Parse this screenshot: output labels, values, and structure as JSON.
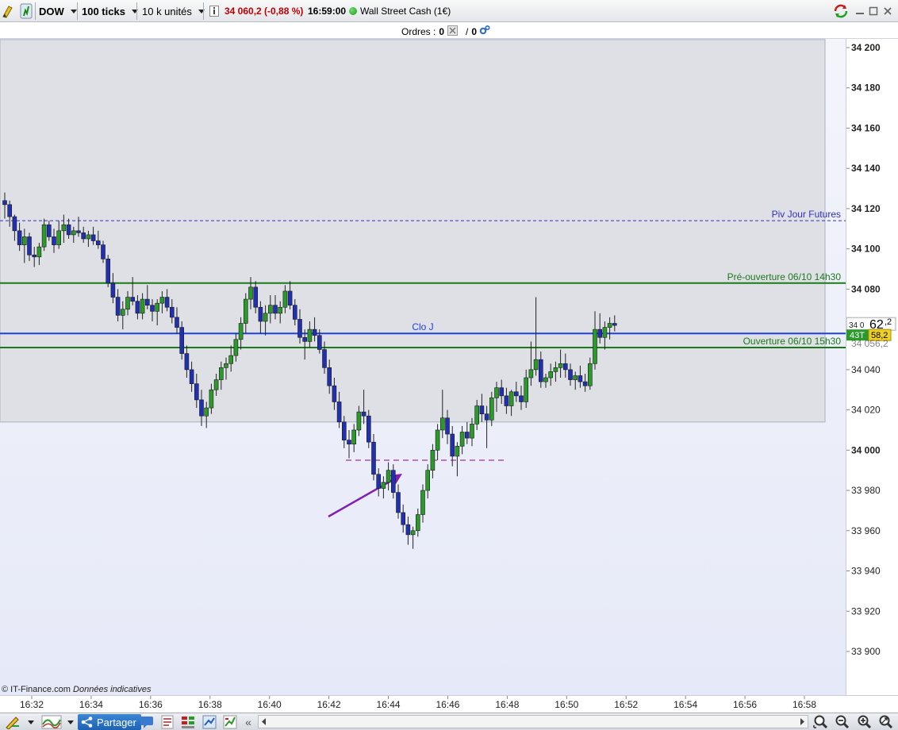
{
  "toolbar": {
    "instrument": "DOW",
    "ticks": "100 ticks",
    "units": "10 k unités",
    "price_change": "34 060,2 (-0,88 %)",
    "time": "16:59:00",
    "market_name": "Wall Street Cash (1€)",
    "icons": [
      "drawing-tool-icon",
      "price-alert-icon",
      "window-minimize-icon",
      "window-restore-icon",
      "window-close-icon",
      "refresh-icon"
    ]
  },
  "orders": {
    "label": "Ordres :",
    "count": "0",
    "slash": "/",
    "count2": "0"
  },
  "chart_data": {
    "type": "candlestick",
    "instrument": "DOW",
    "ylim": [
      33880,
      34205
    ],
    "y_ticks": [
      "34 200",
      "34 180",
      "34 160",
      "34 140",
      "34 120",
      "34 100",
      "34 080",
      "34 060",
      "34 040",
      "34 020",
      "34 000",
      "33 980",
      "33 960",
      "33 940",
      "33 920",
      "33 900"
    ],
    "y_tick_values": [
      34200,
      34180,
      34160,
      34140,
      34120,
      34100,
      34080,
      34060,
      34040,
      34020,
      34000,
      33980,
      33960,
      33940,
      33920,
      33900
    ],
    "x_ticks": [
      "16:32",
      "16:34",
      "16:36",
      "16:38",
      "16:40",
      "16:42",
      "16:44",
      "16:46",
      "16:48",
      "16:50",
      "16:52",
      "16:54",
      "16:56",
      "16:58"
    ],
    "levels": [
      {
        "label": "Piv Jour Futures",
        "value": 34114,
        "color": "#3030c0",
        "style": "dashed"
      },
      {
        "label": "Pré-ouverture 06/10 14h30",
        "value": 34083,
        "color": "#1a7a1a",
        "style": "solid"
      },
      {
        "label": "Clo J",
        "value": 34058,
        "color": "#1e40e0",
        "style": "solid"
      },
      {
        "label": "Ouverture 06/10 15h30",
        "value": 34051,
        "color": "#1a7a1a",
        "style": "solid"
      }
    ],
    "range_box": {
      "top": 34204,
      "bottom": 34014
    },
    "support_line": {
      "value": 33995,
      "from_time": "16:43.8",
      "to_time": "16:47.8",
      "color": "#a030a0"
    },
    "candles": [
      [
        34124,
        34128,
        34115,
        34122
      ],
      [
        34122,
        34124,
        34111,
        34116
      ],
      [
        34116,
        34117,
        34104,
        34109
      ],
      [
        34109,
        34113,
        34099,
        34102
      ],
      [
        34102,
        34110,
        34093,
        34106
      ],
      [
        34106,
        34108,
        34094,
        34097
      ],
      [
        34097,
        34101,
        34091,
        34096
      ],
      [
        34096,
        34103,
        34092,
        34101
      ],
      [
        34101,
        34115,
        34099,
        34112
      ],
      [
        34112,
        34114,
        34104,
        34106
      ],
      [
        34106,
        34110,
        34098,
        34102
      ],
      [
        34102,
        34114,
        34100,
        34109
      ],
      [
        34109,
        34117,
        34103,
        34112
      ],
      [
        34112,
        34115,
        34105,
        34107
      ],
      [
        34107,
        34111,
        34103,
        34109
      ],
      [
        34109,
        34116,
        34106,
        34108
      ],
      [
        34108,
        34111,
        34103,
        34105
      ],
      [
        34105,
        34109,
        34101,
        34107
      ],
      [
        34107,
        34111,
        34102,
        34104
      ],
      [
        34104,
        34109,
        34100,
        34102
      ],
      [
        34102,
        34104,
        34093,
        34095
      ],
      [
        34095,
        34097,
        34081,
        34083
      ],
      [
        34083,
        34088,
        34073,
        34076
      ],
      [
        34076,
        34080,
        34064,
        34067
      ],
      [
        34067,
        34074,
        34060,
        34070
      ],
      [
        34070,
        34079,
        34067,
        34076
      ],
      [
        34076,
        34086,
        34072,
        34074
      ],
      [
        34074,
        34077,
        34065,
        34068
      ],
      [
        34068,
        34078,
        34065,
        34075
      ],
      [
        34075,
        34082,
        34070,
        34072
      ],
      [
        34072,
        34075,
        34064,
        34069
      ],
      [
        34069,
        34075,
        34062,
        34073
      ],
      [
        34073,
        34079,
        34068,
        34076
      ],
      [
        34076,
        34080,
        34069,
        34071
      ],
      [
        34071,
        34075,
        34063,
        34066
      ],
      [
        34066,
        34071,
        34058,
        34061
      ],
      [
        34061,
        34064,
        34045,
        34048
      ],
      [
        34048,
        34052,
        34036,
        34040
      ],
      [
        34040,
        34044,
        34029,
        34033
      ],
      [
        34033,
        34038,
        34021,
        34025
      ],
      [
        34025,
        34030,
        34012,
        34017
      ],
      [
        34017,
        34024,
        34011,
        34021
      ],
      [
        34021,
        34033,
        34018,
        34030
      ],
      [
        34030,
        34038,
        34027,
        34035
      ],
      [
        34035,
        34044,
        34030,
        34041
      ],
      [
        34041,
        34046,
        34035,
        34043
      ],
      [
        34043,
        34052,
        34039,
        34047
      ],
      [
        34047,
        34058,
        34044,
        34055
      ],
      [
        34055,
        34066,
        34050,
        34063
      ],
      [
        34063,
        34078,
        34058,
        34075
      ],
      [
        34075,
        34086,
        34070,
        34081
      ],
      [
        34081,
        34084,
        34068,
        34071
      ],
      [
        34071,
        34074,
        34058,
        34064
      ],
      [
        34064,
        34072,
        34057,
        34068
      ],
      [
        34068,
        34077,
        34063,
        34072
      ],
      [
        34072,
        34077,
        34065,
        34068
      ],
      [
        34068,
        34074,
        34063,
        34071
      ],
      [
        34071,
        34082,
        34068,
        34079
      ],
      [
        34079,
        34084,
        34070,
        34072
      ],
      [
        34072,
        34075,
        34062,
        34065
      ],
      [
        34065,
        34070,
        34053,
        34056
      ],
      [
        34056,
        34060,
        34045,
        34054
      ],
      [
        34054,
        34064,
        34051,
        34060
      ],
      [
        34060,
        34066,
        34054,
        34057
      ],
      [
        34057,
        34060,
        34048,
        34050
      ],
      [
        34050,
        34054,
        34038,
        34041
      ],
      [
        34041,
        34045,
        34028,
        34032
      ],
      [
        34032,
        34036,
        34020,
        34024
      ],
      [
        34024,
        34029,
        34011,
        34014
      ],
      [
        34014,
        34017,
        34001,
        34005
      ],
      [
        34005,
        34010,
        33996,
        34003
      ],
      [
        34003,
        34013,
        33999,
        34010
      ],
      [
        34010,
        34022,
        34007,
        34019
      ],
      [
        34019,
        34030,
        34013,
        34017
      ],
      [
        34017,
        34020,
        34001,
        34004
      ],
      [
        34004,
        34008,
        33985,
        33988
      ],
      [
        33988,
        33991,
        33977,
        33981
      ],
      [
        33981,
        33987,
        33976,
        33984
      ],
      [
        33984,
        33994,
        33980,
        33990
      ],
      [
        33990,
        33993,
        33976,
        33979
      ],
      [
        33979,
        33983,
        33966,
        33969
      ],
      [
        33969,
        33973,
        33959,
        33963
      ],
      [
        33963,
        33967,
        33953,
        33958
      ],
      [
        33958,
        33962,
        33951,
        33960
      ],
      [
        33960,
        33971,
        33957,
        33968
      ],
      [
        33968,
        33983,
        33964,
        33980
      ],
      [
        33980,
        33993,
        33976,
        33990
      ],
      [
        33990,
        34003,
        33986,
        34000
      ],
      [
        34000,
        34013,
        33995,
        34010
      ],
      [
        34010,
        34030,
        34006,
        34016
      ],
      [
        34016,
        34020,
        34003,
        34008
      ],
      [
        34008,
        34012,
        33992,
        33997
      ],
      [
        33997,
        34004,
        33987,
        34002
      ],
      [
        34002,
        34012,
        33998,
        34009
      ],
      [
        34009,
        34014,
        34003,
        34006
      ],
      [
        34006,
        34016,
        34002,
        34013
      ],
      [
        34013,
        34025,
        34010,
        34022
      ],
      [
        34022,
        34028,
        34014,
        34018
      ],
      [
        34018,
        34022,
        34001,
        34015
      ],
      [
        34015,
        34029,
        34012,
        34026
      ],
      [
        34026,
        34034,
        34019,
        34031
      ],
      [
        34031,
        34035,
        34023,
        34027
      ],
      [
        34027,
        34031,
        34018,
        34022
      ],
      [
        34022,
        34030,
        34017,
        34029
      ],
      [
        34029,
        34034,
        34024,
        34027
      ],
      [
        34027,
        34032,
        34020,
        34024
      ],
      [
        34024,
        34040,
        34021,
        34036
      ],
      [
        34036,
        34054,
        34032,
        34040
      ],
      [
        34040,
        34076,
        34037,
        34045
      ],
      [
        34045,
        34049,
        34031,
        34034
      ],
      [
        34034,
        34038,
        34031,
        34036
      ],
      [
        34036,
        34043,
        34032,
        34039
      ],
      [
        34039,
        34044,
        34034,
        34041
      ],
      [
        34041,
        34050,
        34036,
        34043
      ],
      [
        34043,
        34048,
        34036,
        34040
      ],
      [
        34040,
        34043,
        34032,
        34035
      ],
      [
        34035,
        34039,
        34030,
        34037
      ],
      [
        34037,
        34042,
        34031,
        34034
      ],
      [
        34034,
        34038,
        34029,
        34032
      ],
      [
        34032,
        34046,
        34030,
        34043
      ],
      [
        34043,
        34069,
        34040,
        34060
      ],
      [
        34060,
        34068,
        34053,
        34056
      ],
      [
        34056,
        34064,
        34050,
        34061
      ],
      [
        34061,
        34066,
        34055,
        34063
      ],
      [
        34063,
        34067,
        34059,
        34062
      ]
    ],
    "current_price": {
      "label": "43T",
      "value": "58,2",
      "big_value": "62",
      "big_suffix": ",2",
      "prefix": "34 0"
    }
  },
  "axis_labels": {
    "price_prefix_faint": "34 056,2"
  },
  "credit": {
    "brand": "© IT-Finance.com",
    "note": "Données indicatives"
  },
  "bottombar": {
    "share_label": "Partager",
    "collapse_glyph": "«"
  },
  "colors": {
    "bull": "#2a9a2a",
    "bear": "#2030b0",
    "accent": "#c00000"
  }
}
